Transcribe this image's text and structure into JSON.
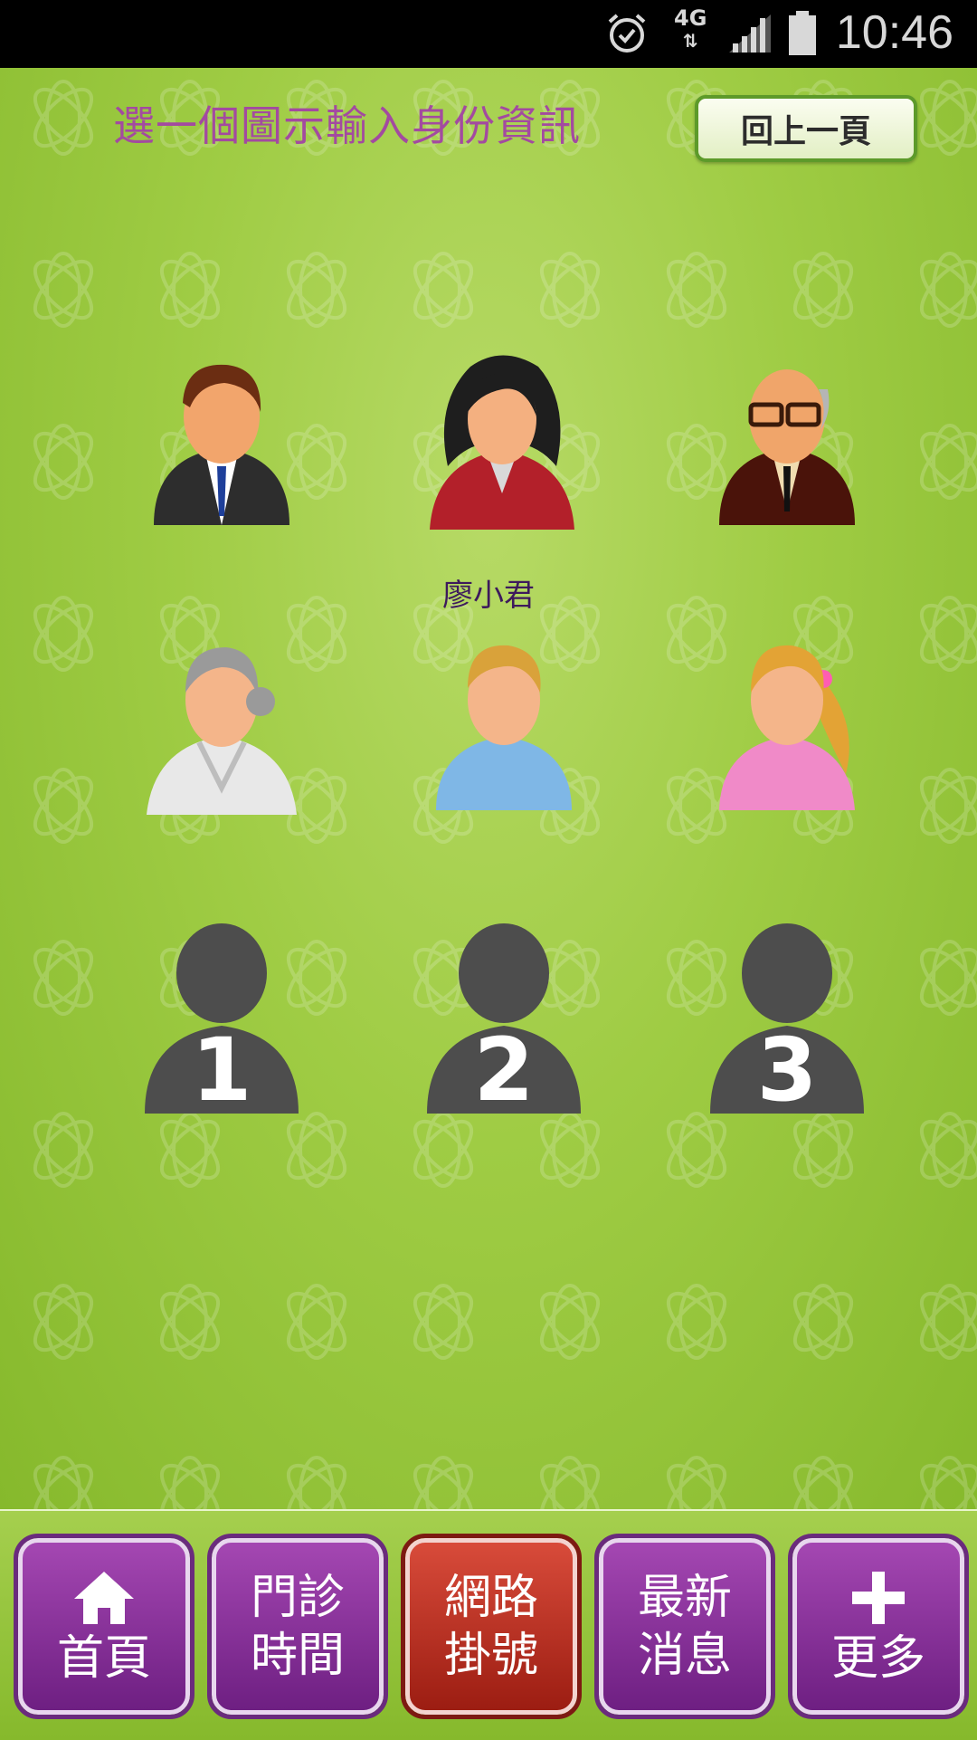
{
  "status_bar": {
    "network": "4G",
    "time": "10:46"
  },
  "header": {
    "title": "選一個圖示輸入身份資訊",
    "back_label": "回上一頁"
  },
  "avatars": [
    {
      "icon": "businessman-icon",
      "name": ""
    },
    {
      "icon": "businesswoman-icon",
      "name": "廖小君"
    },
    {
      "icon": "elderly-man-icon",
      "name": ""
    },
    {
      "icon": "elderly-woman-icon",
      "name": ""
    },
    {
      "icon": "boy-icon",
      "name": ""
    },
    {
      "icon": "girl-icon",
      "name": ""
    },
    {
      "icon": "blank-person-icon",
      "number": "1"
    },
    {
      "icon": "blank-person-icon",
      "number": "2"
    },
    {
      "icon": "blank-person-icon",
      "number": "3"
    }
  ],
  "nav": {
    "home": "首頁",
    "clinic_line1": "門診",
    "clinic_line2": "時間",
    "register_line1": "網路",
    "register_line2": "掛號",
    "news_line1": "最新",
    "news_line2": "消息",
    "more": "更多"
  },
  "colors": {
    "background": "#9fcc44",
    "title": "#a34aa0",
    "nav_button": "#8a32a0",
    "nav_active": "#c2392b"
  }
}
